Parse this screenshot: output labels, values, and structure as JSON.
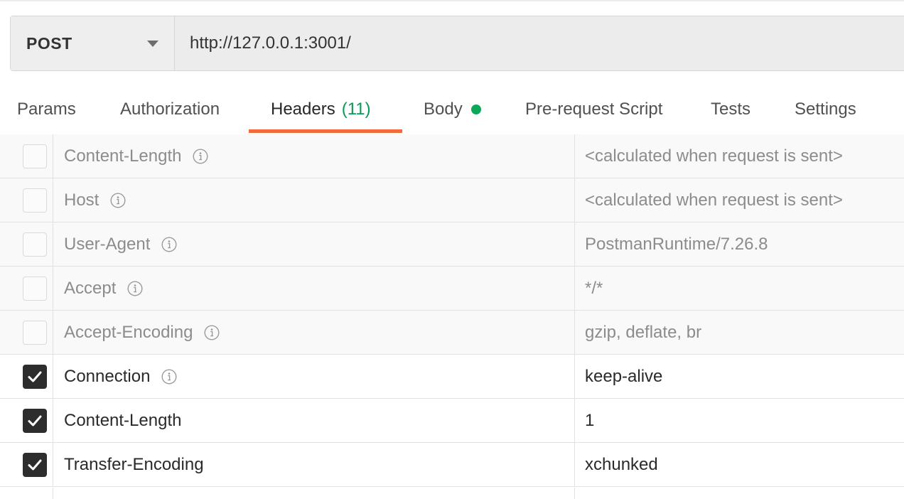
{
  "request": {
    "method": "POST",
    "url": "http://127.0.0.1:3001/"
  },
  "tabs": [
    {
      "label": "Params"
    },
    {
      "label": "Authorization"
    },
    {
      "label": "Headers",
      "count": "(11)",
      "active": true
    },
    {
      "label": "Body",
      "indicator": "green-dot"
    },
    {
      "label": "Pre-request Script"
    },
    {
      "label": "Tests"
    },
    {
      "label": "Settings"
    }
  ],
  "colors": {
    "active_tab_underline": "#f26b3a",
    "count_text": "#0a9a5a",
    "body_dot": "#0ca85a"
  },
  "headers": [
    {
      "checked": false,
      "key": "Content-Length",
      "info": true,
      "value": "<calculated when request is sent>"
    },
    {
      "checked": false,
      "key": "Host",
      "info": true,
      "value": "<calculated when request is sent>"
    },
    {
      "checked": false,
      "key": "User-Agent",
      "info": true,
      "value": "PostmanRuntime/7.26.8"
    },
    {
      "checked": false,
      "key": "Accept",
      "info": true,
      "value": "*/*"
    },
    {
      "checked": false,
      "key": "Accept-Encoding",
      "info": true,
      "value": "gzip, deflate, br"
    },
    {
      "checked": true,
      "key": "Connection",
      "info": true,
      "value": "keep-alive"
    },
    {
      "checked": true,
      "key": "Content-Length",
      "info": false,
      "value": "1"
    },
    {
      "checked": true,
      "key": "Transfer-Encoding",
      "info": false,
      "value": "xchunked"
    }
  ]
}
